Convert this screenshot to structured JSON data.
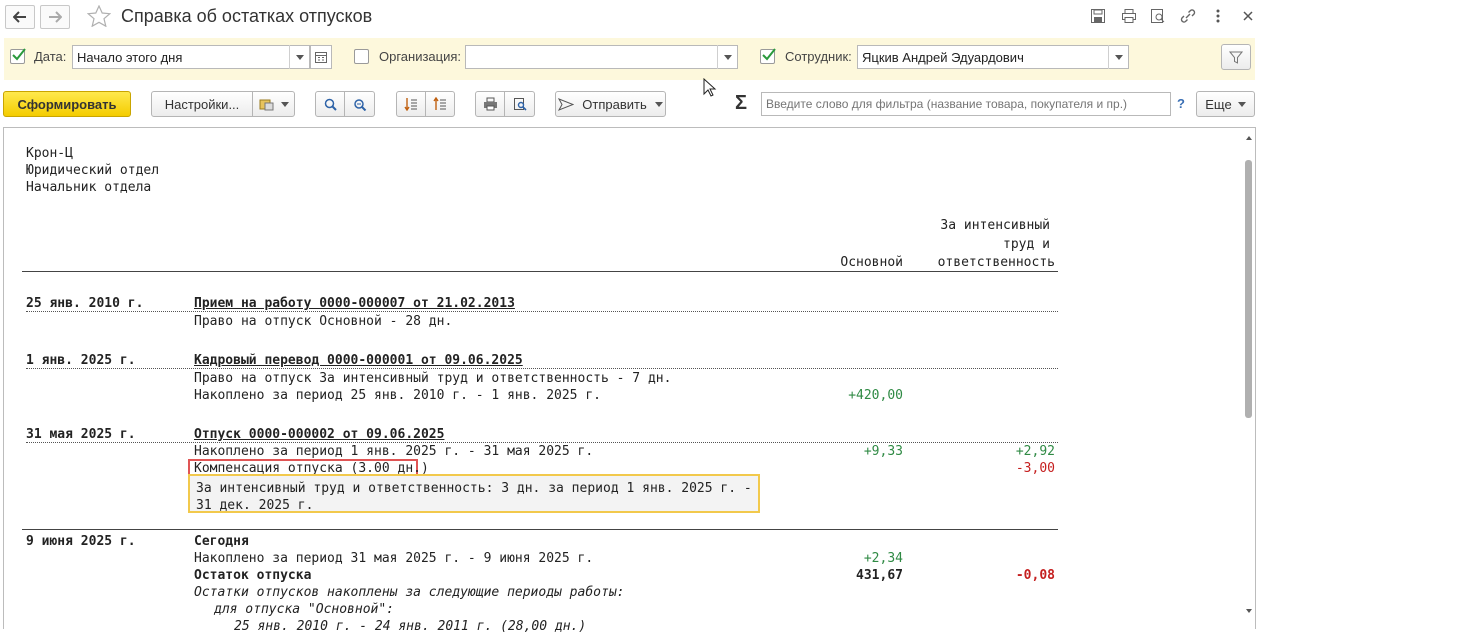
{
  "window": {
    "title": "Справка об остатках отпусков"
  },
  "filters": {
    "date_label": "Дата:",
    "date_value": "Начало этого дня",
    "org_label": "Организация:",
    "org_value": "",
    "employee_label": "Сотрудник:",
    "employee_value": "Яцкив Андрей Эдуардович"
  },
  "toolbar": {
    "generate": "Сформировать",
    "settings": "Настройки...",
    "send": "Отправить",
    "sigma": "Σ",
    "search_placeholder": "Введите слово для фильтра (название товара, покупателя и пр.)",
    "help": "?",
    "more": "Еще"
  },
  "report": {
    "header_lines": [
      "Крон-Ц",
      "Юридический отдел",
      "Начальник отдела"
    ],
    "col1": "Основной",
    "col2_lines": [
      "За интенсивный",
      "труд и",
      "ответственность"
    ],
    "s1": {
      "date": "25 янв. 2010 г.",
      "doc": "Прием на работу 0000-000007 от 21.02.2013",
      "line1": "Право на отпуск Основной - 28 дн."
    },
    "s2": {
      "date": "1 янв. 2025 г.",
      "doc": "Кадровый перевод 0000-000001 от 09.06.2025",
      "line1": "Право на отпуск За интенсивный труд и ответственность - 7 дн.",
      "line2": "Накоплено за период 25 янв. 2010 г. - 1 янв. 2025 г.",
      "line2_v1": "+420,00"
    },
    "s3": {
      "date": "31 мая 2025 г.",
      "doc": "Отпуск 0000-000002 от 09.06.2025",
      "line1": "Накоплено за период 1 янв. 2025 г. - 31 мая 2025 г.",
      "line1_v1": "+9,33",
      "line1_v2": "+2,92",
      "comp": "Компенсация отпуска (3.00 дн.)",
      "comp_v2": "-3,00",
      "tooltip": "За интенсивный труд и ответственность: 3 дн. за период 1 янв. 2025 г. - 31 дек. 2025 г."
    },
    "s4": {
      "date": "9 июня 2025 г.",
      "title": "Сегодня",
      "line1": "Накоплено за период 31 мая 2025 г. - 9 июня 2025 г.",
      "line1_v1": "+2,34",
      "rest": "Остаток отпуска",
      "rest_v1": "431,67",
      "rest_v2": "-0,08",
      "note": "Остатки отпусков накоплены за следующие периоды работы:",
      "note2": "для отпуска \"Основной\":",
      "note3": "25 янв. 2010 г. - 24 янв. 2011 г. (28,00 дн.)"
    }
  }
}
